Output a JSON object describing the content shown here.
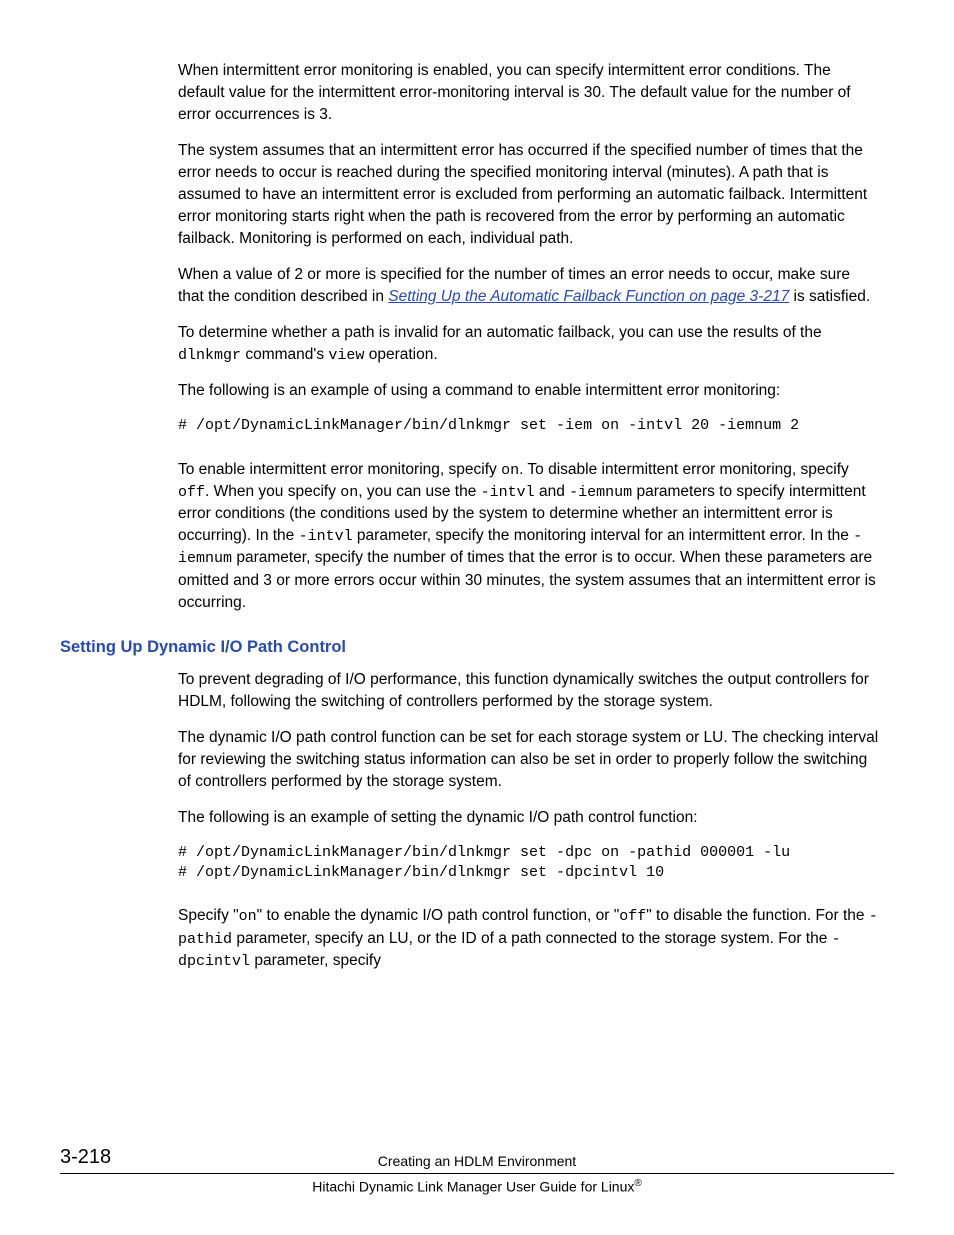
{
  "para1": "When intermittent error monitoring is enabled, you can specify intermittent error conditions. The default value for the intermittent error-monitoring interval is 30. The default value for the number of error occurrences is 3.",
  "para2": "The system assumes that an intermittent error has occurred if the specified number of times that the error needs to occur is reached during the specified monitoring interval (minutes). A path that is assumed to have an intermittent error is excluded from performing an automatic failback. Intermittent error monitoring starts right when the path is recovered from the error by performing an automatic failback. Monitoring is performed on each, individual path.",
  "para3_a": "When a value of 2 or more is specified for the number of times an error needs to occur, make sure that the condition described in ",
  "para3_link": "Setting Up the Automatic Failback Function on page 3-217",
  "para3_b": " is satisfied.",
  "para4_a": "To determine whether a path is invalid for an automatic failback, you can use the results of the ",
  "para4_code1": "dlnkmgr",
  "para4_b": " command's ",
  "para4_code2": "view",
  "para4_c": " operation.",
  "para5": "The following is an example of using a command to enable intermittent error monitoring:",
  "cmd1": "# /opt/DynamicLinkManager/bin/dlnkmgr set -iem on -intvl 20 -iemnum 2",
  "para6_a": "To enable intermittent error monitoring, specify ",
  "c_on": "on",
  "para6_b": ". To disable intermittent error monitoring, specify ",
  "c_off": "off",
  "para6_c": ". When you specify ",
  "para6_d": ", you can use the ",
  "c_intvl": "-intvl",
  "para6_e": " and ",
  "c_iemnum": "-iemnum",
  "para6_f": " parameters to specify intermittent error conditions (the conditions used by the system to determine whether an intermittent error is occurring). In the ",
  "para6_g": " parameter, specify the monitoring interval for an intermittent error. In the ",
  "para6_h": " parameter, specify the number of times that the error is to occur. When these parameters are omitted and 3 or more errors occur within 30 minutes, the system assumes that an intermittent error is occurring.",
  "heading2": "Setting Up Dynamic I/O Path Control",
  "para7": "To prevent degrading of I/O performance, this function dynamically switches the output controllers for HDLM, following the switching of controllers performed by the storage system.",
  "para8": "The dynamic I/O path control function can be set for each storage system or LU. The checking interval for reviewing the switching status information can also be set in order to properly follow the switching of controllers performed by the storage system.",
  "para9": "The following is an example of setting the dynamic I/O path control function:",
  "cmd2": "# /opt/DynamicLinkManager/bin/dlnkmgr set -dpc on -pathid 000001 -lu\n# /opt/DynamicLinkManager/bin/dlnkmgr set -dpcintvl 10",
  "para10_a": "Specify \"",
  "para10_b": "\" to enable the dynamic I/O path control function, or \"",
  "para10_c": "\" to disable the function. For the ",
  "c_pathid": "-pathid",
  "para10_d": " parameter, specify an LU, or the ID of a path connected to the storage system. For the ",
  "c_dpcintvl": "-dpcintvl",
  "para10_e": " parameter, specify",
  "footer_pagenum": "3-218",
  "footer_chapter": "Creating an HDLM Environment",
  "footer_title_a": "Hitachi Dynamic Link Manager User Guide for Linux",
  "footer_title_reg": "®"
}
